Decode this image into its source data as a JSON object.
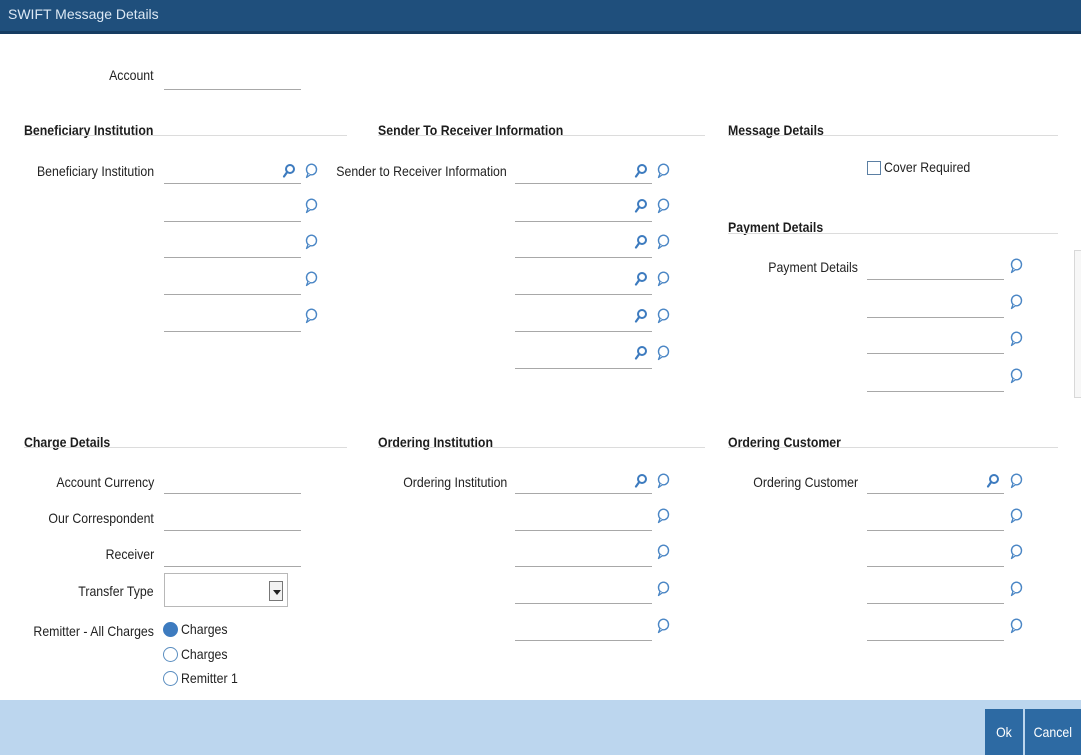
{
  "window": {
    "title": "SWIFT Message Details"
  },
  "account": {
    "label": "Account",
    "value": ""
  },
  "beneficiary": {
    "section": "Beneficiary Institution",
    "label": "Beneficiary Institution",
    "lines": [
      "",
      "",
      "",
      "",
      ""
    ]
  },
  "sender_receiver": {
    "section": "Sender To Receiver Information",
    "label": "Sender to Receiver Information",
    "lines": [
      "",
      "",
      "",
      "",
      "",
      ""
    ]
  },
  "message_details": {
    "section": "Message Details",
    "cover_required_label": "Cover Required",
    "cover_required": false
  },
  "payment_details": {
    "section": "Payment Details",
    "label": "Payment Details",
    "lines": [
      "",
      "",
      "",
      ""
    ]
  },
  "charge_details": {
    "section": "Charge Details",
    "account_currency_label": "Account Currency",
    "our_correspondent_label": "Our Correspondent",
    "receiver_label": "Receiver",
    "transfer_type_label": "Transfer Type",
    "transfer_type_value": "",
    "remitter_label": "Remitter - All Charges",
    "options": [
      "Charges",
      "Charges",
      "Remitter 1"
    ],
    "selected_option_index": 0
  },
  "ordering_institution": {
    "section": "Ordering Institution",
    "label": "Ordering Institution",
    "lines": [
      "",
      "",
      "",
      "",
      ""
    ]
  },
  "ordering_customer": {
    "section": "Ordering Customer",
    "label": "Ordering Customer",
    "lines": [
      "",
      "",
      "",
      "",
      ""
    ]
  },
  "footer": {
    "ok_label": "Ok",
    "cancel_label": "Cancel"
  },
  "icons": {
    "lookup": "search-icon",
    "text_edit": "comment-icon"
  },
  "colors": {
    "title_bar": "#1f4f7c",
    "footer": "#bcd6ee",
    "button": "#2d6aa3",
    "radio_selected": "#3d7bbf"
  }
}
